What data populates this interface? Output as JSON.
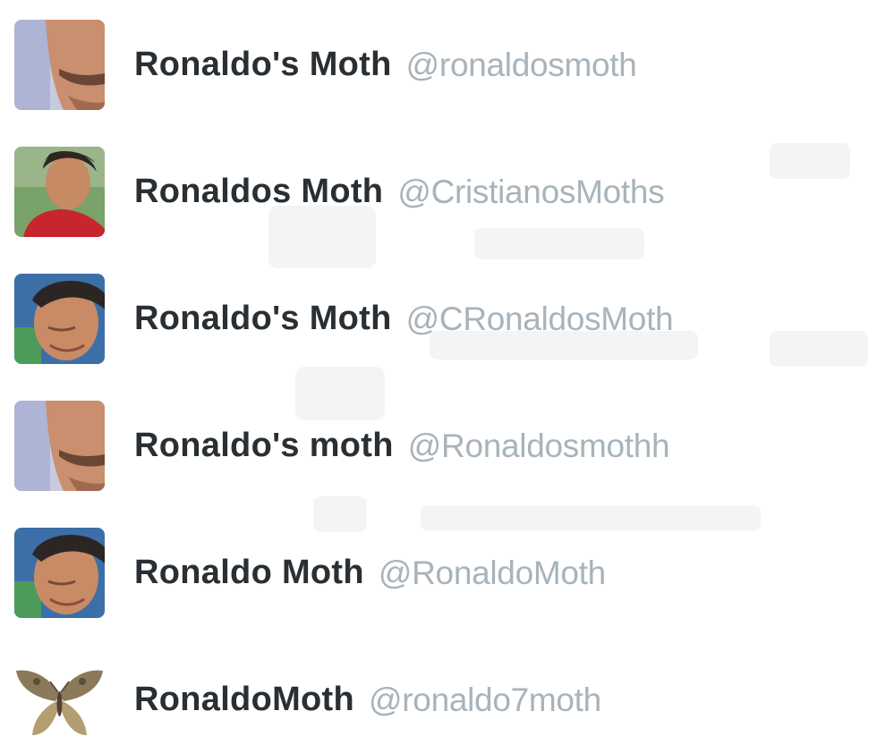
{
  "accounts": [
    {
      "name": "Ronaldo's Moth",
      "handle": "@ronaldosmoth",
      "avatar": "ronaldo-closeup-photo"
    },
    {
      "name": "Ronaldos Moth",
      "handle": "@CristianosMoths",
      "avatar": "ronaldo-red-kit-photo"
    },
    {
      "name": "Ronaldo's Moth",
      "handle": "@CRonaldosMoth",
      "avatar": "ronaldo-face-photo"
    },
    {
      "name": "Ronaldo's moth",
      "handle": "@Ronaldosmothh",
      "avatar": "ronaldo-closeup-photo"
    },
    {
      "name": "Ronaldo Moth",
      "handle": "@RonaldoMoth",
      "avatar": "ronaldo-face-photo"
    },
    {
      "name": "RonaldoMoth",
      "handle": "@ronaldo7moth",
      "avatar": "moth-photo"
    }
  ],
  "colors": {
    "name_text": "#292f33",
    "handle_text": "#a8b3bb",
    "background": "#ffffff"
  }
}
